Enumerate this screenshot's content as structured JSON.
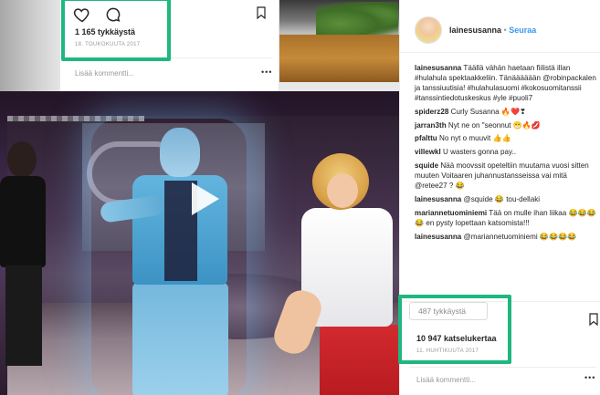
{
  "top_post": {
    "likes": "1 165 tykkäystä",
    "date": "18. TOUKOKUUTA 2017",
    "add_comment_placeholder": "Lisää kommentti...",
    "more": "•••"
  },
  "right_post": {
    "username": "lainesusanna",
    "separator": "•",
    "follow": "Seuraa",
    "comments": [
      {
        "user": "lainesusanna",
        "text": "Täällä vähän haetaan fiilistä illan #hulahula spektaakkeliin. Tänääääään @robinpackalen ja tanssiuutisia! #hulahulasuomi #kokosuomitanssii #tanssintiedotuskeskus #yle #puoli7"
      },
      {
        "user": "spiderz28",
        "text": "Curly Susanna 🔥❤️❣"
      },
      {
        "user": "jarran3th",
        "text": "Nyt ne on \"seonnut 😁🔥💋"
      },
      {
        "user": "pfalttu",
        "text": "No nyt o muuvit 👍👍"
      },
      {
        "user": "villewkl",
        "text": "U wasters gonna pay.."
      },
      {
        "user": "squide",
        "text": "Nää moovssit opeteltiin muutama vuosi sitten muuten Voitaaren juhannustansseissa vai mitä @retee27 ? 😂"
      },
      {
        "user": "lainesusanna",
        "text": "@squide 😂 tou-dellaki"
      },
      {
        "user": "mariannetuominiemi",
        "text": "Tää on mulle ihan liikaa 😂😂😂😂 en pysty lopettaan katsomista!!!"
      },
      {
        "user": "lainesusanna",
        "text": "@mariannetuominiemi 😂😂😂😂"
      }
    ],
    "likes_tooltip": "487 tykkäystä",
    "views": "10 947 katselukertaa",
    "date": "11. HUHTIKUUTA 2017",
    "add_comment_placeholder": "Lisää kommentti...",
    "more": "•••"
  },
  "colors": {
    "highlight": "#1fb77f",
    "link": "#003569",
    "follow": "#3897f0"
  }
}
